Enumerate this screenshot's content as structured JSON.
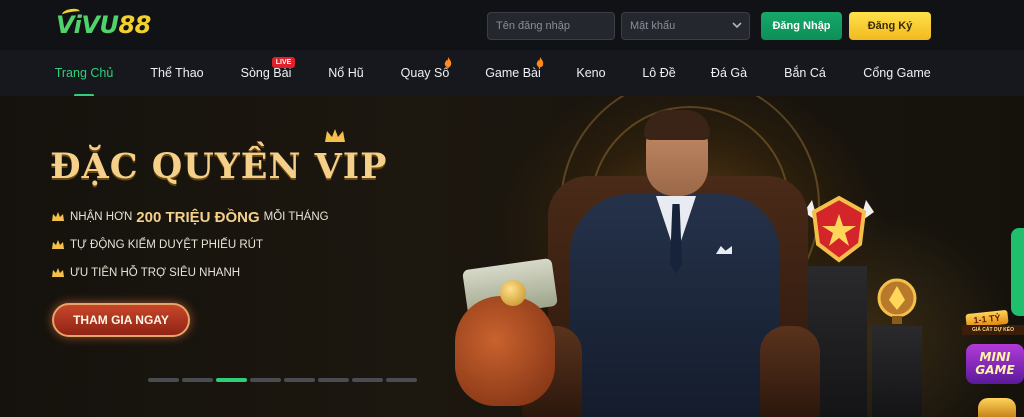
{
  "header": {
    "logo_part1": "ViVU",
    "logo_part2": "88",
    "username_placeholder": "Tên đăng nhập",
    "password_placeholder": "Mật khẩu",
    "login_label": "Đăng Nhập",
    "register_label": "Đăng Ký"
  },
  "nav": {
    "items": [
      {
        "label": "Trang Chủ",
        "active": true
      },
      {
        "label": "Thể Thao"
      },
      {
        "label": "Sòng Bài",
        "badge": "LIVE"
      },
      {
        "label": "Nổ Hũ"
      },
      {
        "label": "Quay Số",
        "icon": "fire-icon"
      },
      {
        "label": "Game Bài",
        "icon": "fire-icon"
      },
      {
        "label": "Keno"
      },
      {
        "label": "Lô Đề"
      },
      {
        "label": "Đá Gà"
      },
      {
        "label": "Bắn Cá"
      },
      {
        "label": "Cổng Game"
      }
    ]
  },
  "banner": {
    "title": "ĐẶC QUYỀN VIP",
    "perks": [
      {
        "prefix": "NHẬN HƠN",
        "highlight": "200 TRIỆU ĐỒNG",
        "suffix": "MỖI THÁNG"
      },
      {
        "text": "TỰ ĐỘNG KIỂM DUYỆT PHIẾU RÚT"
      },
      {
        "text": "ƯU TIÊN HỖ TRỢ SIÊU NHANH"
      }
    ],
    "cta_label": "THAM GIA NGAY",
    "slide_count": 8,
    "active_slide": 3
  },
  "side_promo": {
    "badge": "1-1 TỶ",
    "label": "GIẢ CÁT DỰ KÉO",
    "mini_game_line1": "MINI",
    "mini_game_line2": "GAME"
  },
  "colors": {
    "accent_green": "#2fcf7a",
    "gold": "#f4d08a",
    "live_red": "#e0202a"
  }
}
